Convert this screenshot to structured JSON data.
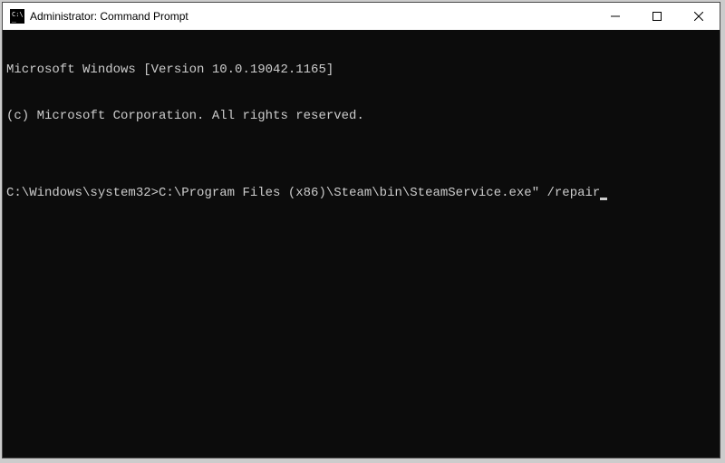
{
  "window": {
    "title": "Administrator: Command Prompt"
  },
  "terminal": {
    "line1": "Microsoft Windows [Version 10.0.19042.1165]",
    "line2": "(c) Microsoft Corporation. All rights reserved.",
    "blank1": "",
    "prompt": "C:\\Windows\\system32>",
    "command": "C:\\Program Files (x86)\\Steam\\bin\\SteamService.exe\" /repair"
  }
}
